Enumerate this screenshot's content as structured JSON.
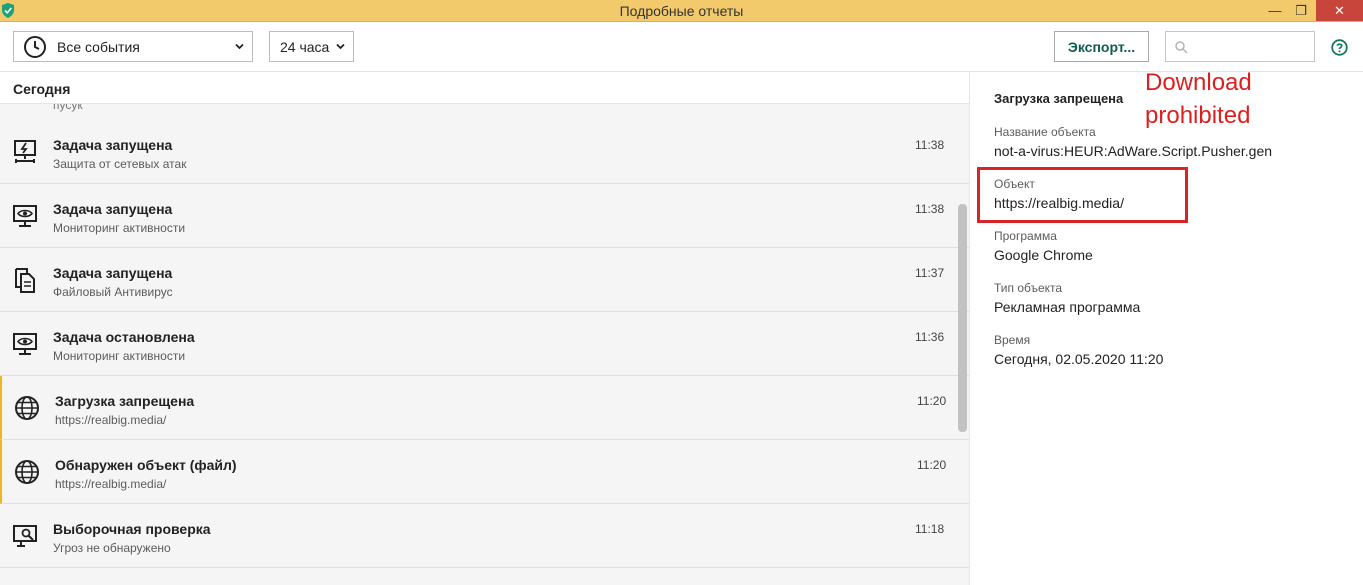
{
  "window": {
    "title": "Подробные отчеты",
    "minimize_glyph": "—",
    "maximize_glyph": "❐",
    "close_glyph": "✕"
  },
  "toolbar": {
    "events_select": "Все события",
    "period_select": "24 часа",
    "export_label": "Экспорт...",
    "search_value": ""
  },
  "list": {
    "section": "Сегодня",
    "clipped_fragment": "пусук",
    "rows": [
      {
        "title": "Задача запущена",
        "subtitle": "Защита от сетевых атак",
        "time": "11:38",
        "icon": "network-attack-icon"
      },
      {
        "title": "Задача запущена",
        "subtitle": "Мониторинг активности",
        "time": "11:38",
        "icon": "activity-monitor-icon"
      },
      {
        "title": "Задача запущена",
        "subtitle": "Файловый Антивирус",
        "time": "11:37",
        "icon": "file-antivirus-icon"
      },
      {
        "title": "Задача остановлена",
        "subtitle": "Мониторинг активности",
        "time": "11:36",
        "icon": "activity-monitor-icon"
      },
      {
        "title": "Загрузка запрещена",
        "subtitle": "https://realbig.media/",
        "time": "11:20",
        "icon": "globe-icon"
      },
      {
        "title": "Обнаружен объект (файл)",
        "subtitle": "https://realbig.media/",
        "time": "11:20",
        "icon": "globe-icon"
      },
      {
        "title": "Выборочная проверка",
        "subtitle": "Угроз не обнаружено",
        "time": "11:18",
        "icon": "custom-scan-icon"
      }
    ]
  },
  "details": {
    "heading": "Загрузка запрещена",
    "fields": [
      {
        "label": "Название объекта",
        "value": "not-a-virus:HEUR:AdWare.Script.Pusher.gen"
      },
      {
        "label": "Объект",
        "value": "https://realbig.media/"
      },
      {
        "label": "Программа",
        "value": "Google Chrome"
      },
      {
        "label": "Тип объекта",
        "value": "Рекламная программа"
      },
      {
        "label": "Время",
        "value": "Сегодня, 02.05.2020 11:20"
      }
    ]
  },
  "annotation": {
    "text": "Download\nprohibited",
    "color": "#dd1f1f"
  },
  "colors": {
    "titlebar": "#f2c96b",
    "accent_green": "#0f5d51",
    "selected_marker": "#f1b51d"
  }
}
